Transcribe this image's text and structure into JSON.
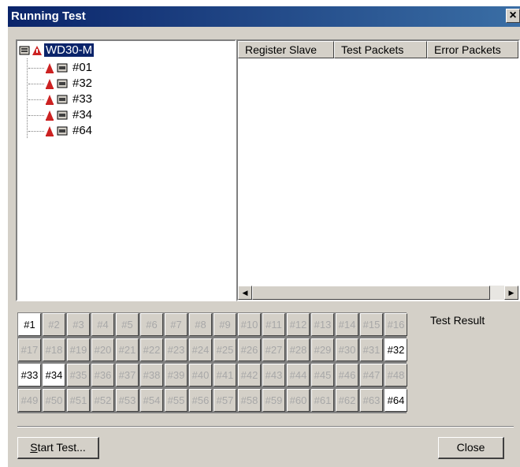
{
  "window": {
    "title": "Running Test"
  },
  "tree": {
    "root": "WD30-M",
    "children": [
      "#01",
      "#32",
      "#33",
      "#34",
      "#64"
    ]
  },
  "list": {
    "columns": [
      "Register Slave",
      "Test Packets",
      "Error Packets"
    ]
  },
  "slaves": {
    "cells": [
      "#1",
      "#2",
      "#3",
      "#4",
      "#5",
      "#6",
      "#7",
      "#8",
      "#9",
      "#10",
      "#11",
      "#12",
      "#13",
      "#14",
      "#15",
      "#16",
      "#17",
      "#18",
      "#19",
      "#20",
      "#21",
      "#22",
      "#23",
      "#24",
      "#25",
      "#26",
      "#27",
      "#28",
      "#29",
      "#30",
      "#31",
      "#32",
      "#33",
      "#34",
      "#35",
      "#36",
      "#37",
      "#38",
      "#39",
      "#40",
      "#41",
      "#42",
      "#43",
      "#44",
      "#45",
      "#46",
      "#47",
      "#48",
      "#49",
      "#50",
      "#51",
      "#52",
      "#53",
      "#54",
      "#55",
      "#56",
      "#57",
      "#58",
      "#59",
      "#60",
      "#61",
      "#62",
      "#63",
      "#64"
    ],
    "active": [
      "#1",
      "#32",
      "#33",
      "#34",
      "#64"
    ]
  },
  "result": {
    "label": "Test Result"
  },
  "buttons": {
    "start": "Start Test...",
    "close": "Close"
  },
  "colors": {
    "title_bar": "#0a246a",
    "face": "#d4d0c8",
    "icon_red": "#cc2222"
  }
}
